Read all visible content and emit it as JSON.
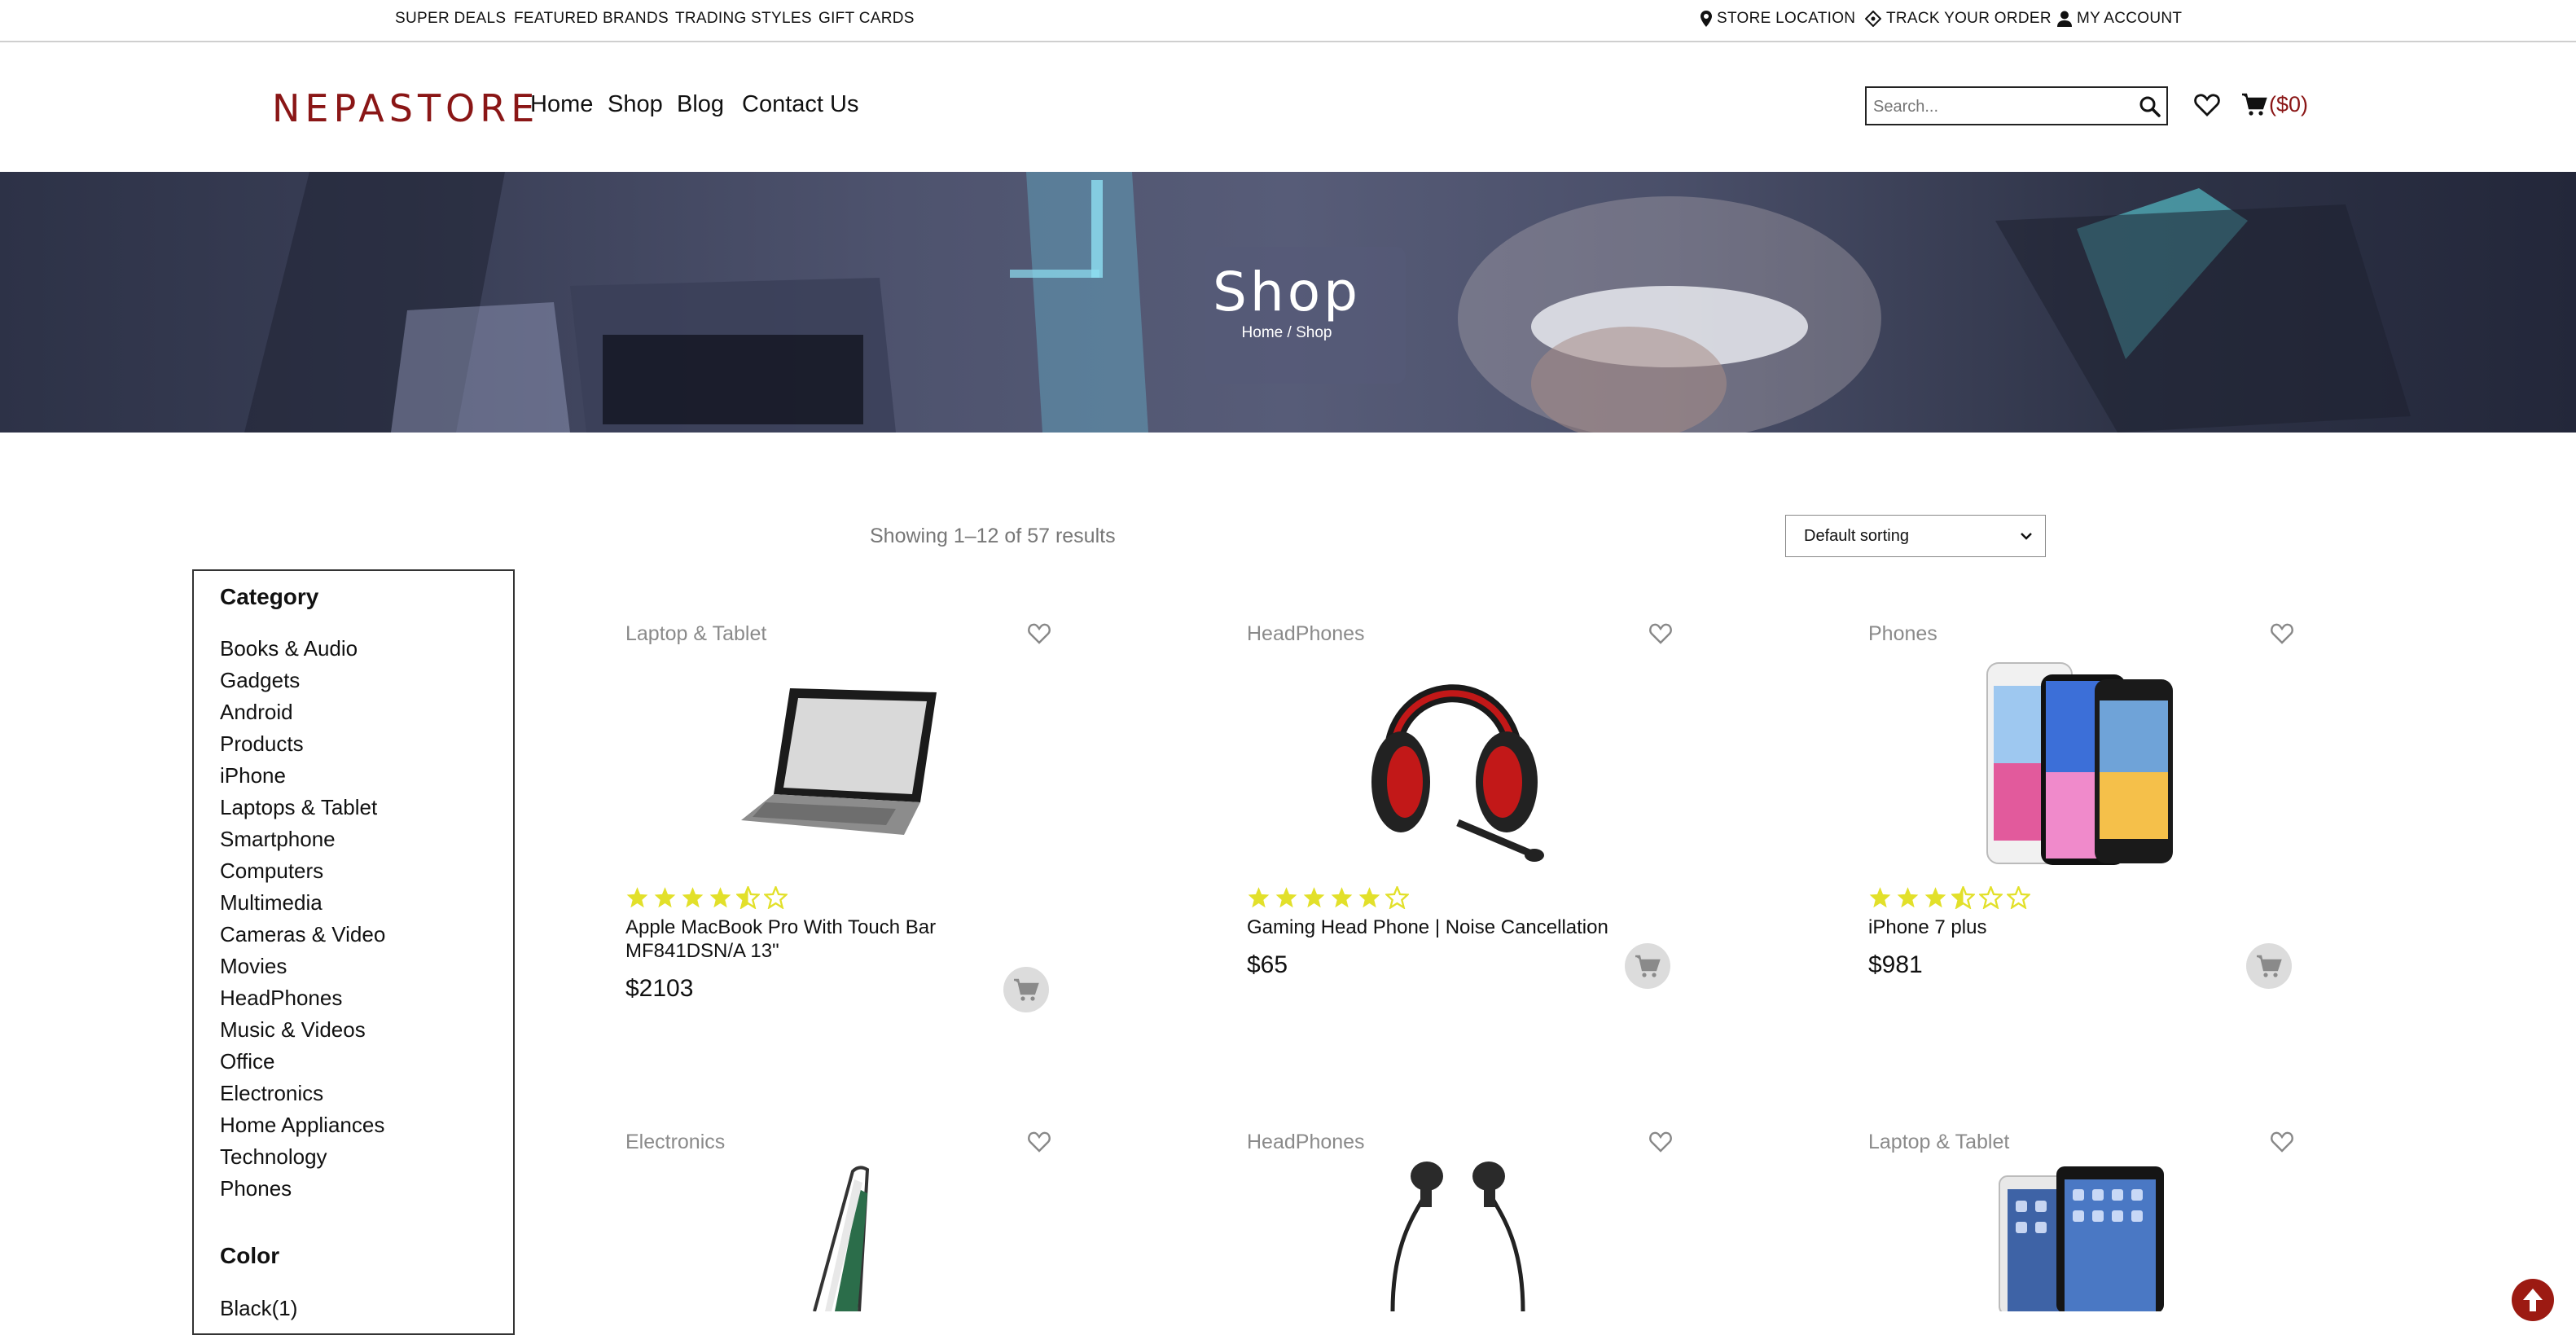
{
  "topbar": {
    "links": [
      "SUPER DEALS",
      "FEATURED BRANDS",
      "TRADING STYLES",
      "GIFT CARDS"
    ],
    "store_location": "STORE LOCATION",
    "track_order": "TRACK YOUR ORDER",
    "my_account": "MY ACCOUNT"
  },
  "header": {
    "logo": "NEPASTORE",
    "nav": [
      "Home",
      "Shop",
      "Blog",
      "Contact Us"
    ],
    "search_placeholder": "Search...",
    "cart_amount": "($0)"
  },
  "hero": {
    "title": "Shop",
    "breadcrumb": [
      "Home",
      "/",
      "Shop"
    ]
  },
  "toolbar": {
    "results": "Showing 1–12 of 57 results",
    "sort": "Default sorting"
  },
  "sidebar": {
    "category_title": "Category",
    "categories": [
      "Books & Audio",
      "Gadgets",
      "Android",
      "Products",
      "iPhone",
      "Laptops & Tablet",
      "Smartphone",
      "Computers",
      "Multimedia",
      "Cameras & Video",
      "Movies",
      "HeadPhones",
      "Music & Videos",
      "Office",
      "Electronics",
      "Home Appliances",
      "Technology",
      "Phones"
    ],
    "color_title": "Color",
    "colors": [
      "Black(1)"
    ]
  },
  "products": [
    {
      "category": "Laptop & Tablet",
      "title_lines": [
        "Apple MacBook Pro With Touch Bar",
        "MF841DSN/A 13\""
      ],
      "price": "$2103",
      "rating": 4.5,
      "icon": "laptop-image"
    },
    {
      "category": "HeadPhones",
      "title_lines": [
        "Gaming Head Phone | Noise Cancellation"
      ],
      "price": "$65",
      "rating": 5,
      "icon": "headphone-image"
    },
    {
      "category": "Phones",
      "title_lines": [
        "iPhone 7 plus"
      ],
      "price": "$981",
      "rating": 3.5,
      "icon": "phones-image"
    },
    {
      "category": "Electronics",
      "icon": "phone-case-image"
    },
    {
      "category": "HeadPhones",
      "icon": "earphones-image"
    },
    {
      "category": "Laptop & Tablet",
      "icon": "tablets-image"
    }
  ],
  "colors": {
    "brand": "#8a1616",
    "star": "#e2e02a",
    "scroll_top": "#9c1a12"
  }
}
